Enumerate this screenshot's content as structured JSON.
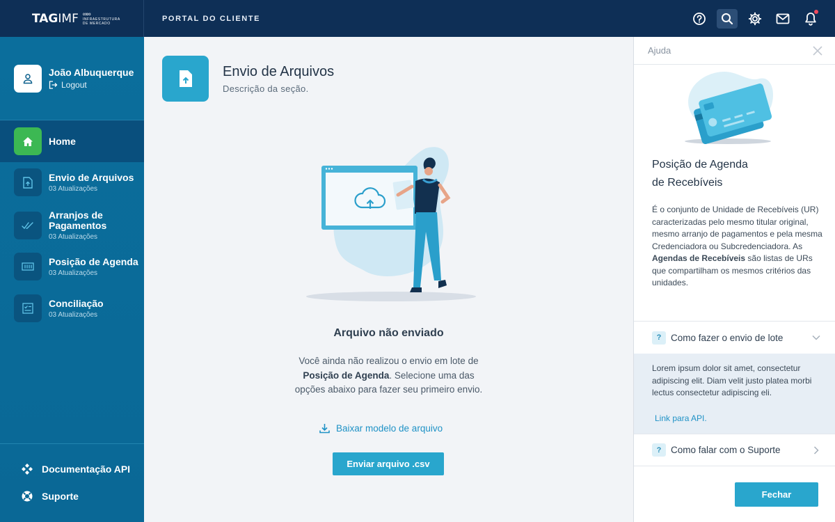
{
  "header": {
    "logo_main": "TAG",
    "logo_thin": "IMF",
    "logo_sub_line1": "INFRAESTRUTURA",
    "logo_sub_line2": "DE MERCADO",
    "portal_label": "PORTAL DO CLIENTE",
    "icons": [
      "help-icon",
      "search-icon",
      "gear-icon",
      "mail-icon",
      "bell-icon"
    ]
  },
  "user": {
    "name": "João Albuquerque",
    "logout_label": "Logout"
  },
  "sidebar": {
    "home_label": "Home",
    "items": [
      {
        "title": "Envio de Arquivos",
        "sub": "03 Atualizações",
        "icon": "file-upload-icon"
      },
      {
        "title": "Arranjos de Pagamentos",
        "sub": "03 Atualizações",
        "icon": "double-check-icon"
      },
      {
        "title": "Posição de Agenda",
        "sub": "03 Atualizações",
        "icon": "grid-icon"
      },
      {
        "title": "Conciliação",
        "sub": "03 Atualizações",
        "icon": "checklist-icon"
      }
    ],
    "bottom": {
      "docs_label": "Documentação API",
      "support_label": "Suporte"
    }
  },
  "main": {
    "section_title": "Envio de Arquivos",
    "section_desc": "Descrição da seção.",
    "empty_title": "Arquivo não enviado",
    "empty_text_1": "Você ainda não realizou o envio em lote de",
    "empty_text_bold": "Posição de Agenda",
    "empty_text_2": ". Selecione uma das",
    "empty_text_3": "opções abaixo para fazer seu primeiro envio.",
    "download_label": "Baixar modelo de arquivo",
    "send_label": "Enviar arquivo .csv"
  },
  "help": {
    "header_label": "Ajuda",
    "title_line1": "Posição de Agenda",
    "title_line2": "de Recebíveis",
    "body_1": "É o conjunto de Unidade de Recebíveis (UR) caracterizadas pelo mesmo titular original, mesmo arranjo de pagamentos e pela mesma Credenciadora ou Subcredenciadora. As ",
    "body_bold": "Agendas de Recebíveis",
    "body_2": " são listas de URs que compartilham os mesmos critérios das unidades.",
    "accordion": [
      {
        "badge": "?",
        "label": "Como fazer o envio de lote",
        "expanded": true,
        "content": "Lorem ipsum dolor sit amet, consectetur adipiscing elit. Diam velit justo platea morbi lectus consectetur adipiscing eli.",
        "link": "Link para API."
      },
      {
        "badge": "?",
        "label": "Como falar com o Suporte",
        "expanded": false
      }
    ],
    "close_label": "Fechar"
  },
  "colors": {
    "topbar": "#0e2f56",
    "sidebar": "#0b6e9c",
    "accent": "#29a6cd",
    "home_green": "#3cb853"
  }
}
